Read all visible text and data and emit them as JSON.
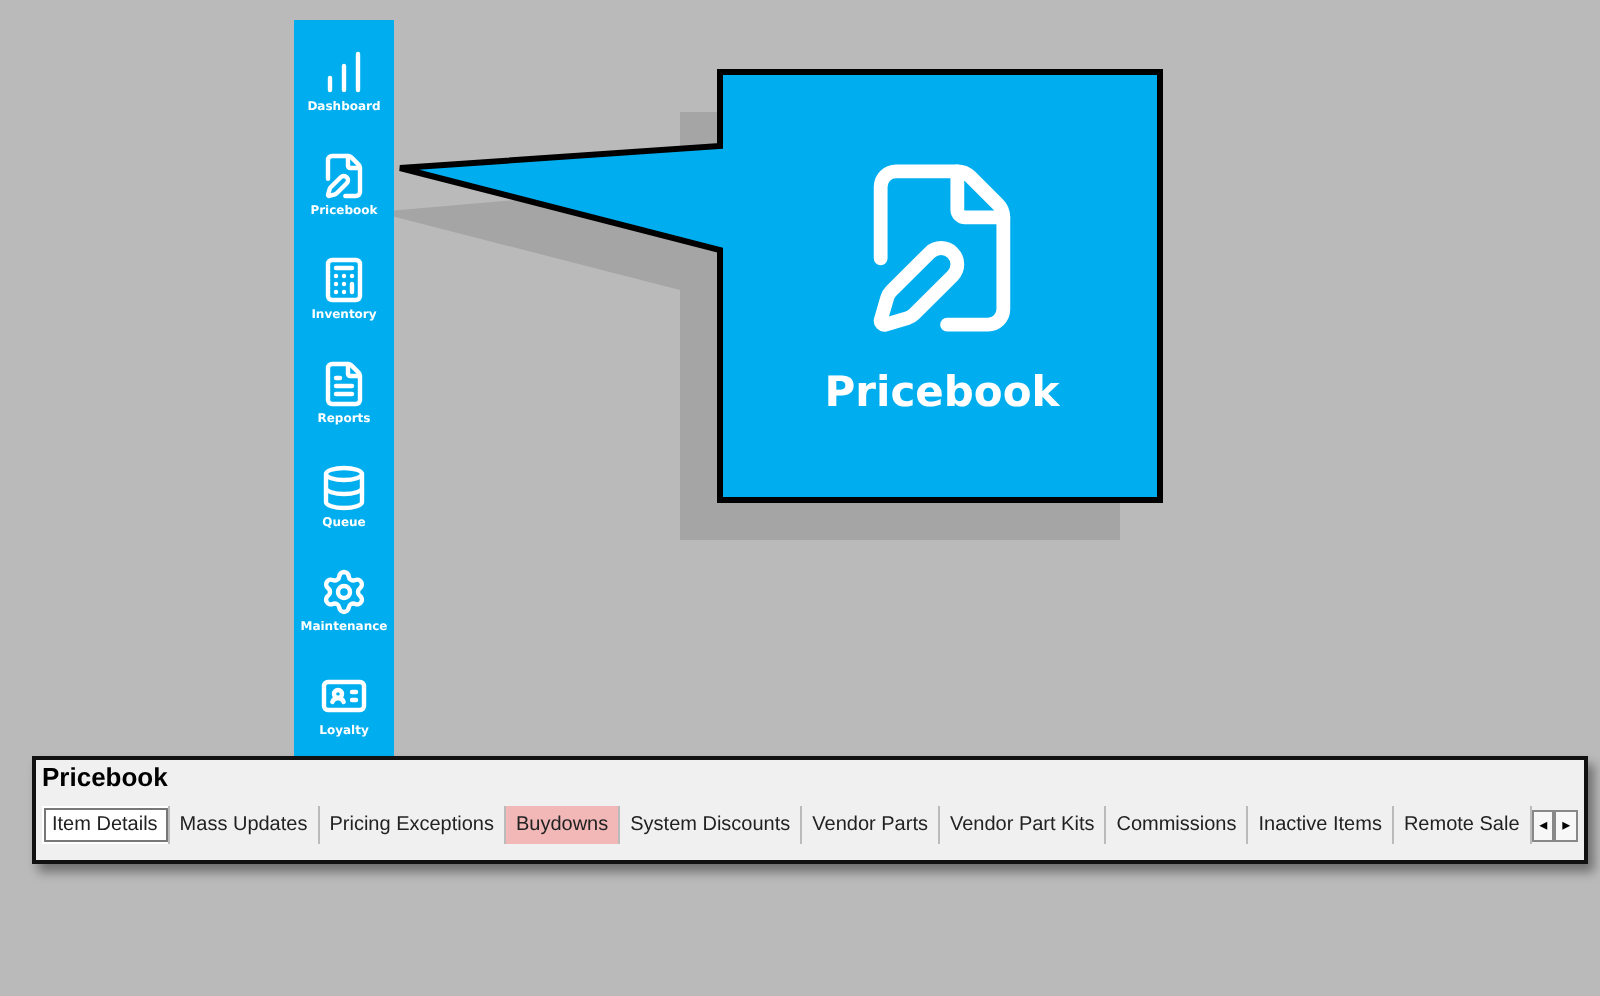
{
  "sidebar": {
    "items": [
      {
        "label": "Dashboard"
      },
      {
        "label": "Pricebook"
      },
      {
        "label": "Inventory"
      },
      {
        "label": "Reports"
      },
      {
        "label": "Queue"
      },
      {
        "label": "Maintenance"
      },
      {
        "label": "Loyalty"
      }
    ]
  },
  "callout": {
    "label": "Pricebook"
  },
  "panel": {
    "title": "Pricebook",
    "tabs": [
      {
        "label": "Item Details",
        "selected": true,
        "highlighted": false
      },
      {
        "label": "Mass Updates",
        "selected": false,
        "highlighted": false
      },
      {
        "label": "Pricing Exceptions",
        "selected": false,
        "highlighted": false
      },
      {
        "label": "Buydowns",
        "selected": false,
        "highlighted": true
      },
      {
        "label": "System Discounts",
        "selected": false,
        "highlighted": false
      },
      {
        "label": "Vendor Parts",
        "selected": false,
        "highlighted": false
      },
      {
        "label": "Vendor Part Kits",
        "selected": false,
        "highlighted": false
      },
      {
        "label": "Commissions",
        "selected": false,
        "highlighted": false
      },
      {
        "label": "Inactive Items",
        "selected": false,
        "highlighted": false
      },
      {
        "label": "Remote Sale",
        "selected": false,
        "highlighted": false
      }
    ],
    "scroll_buttons": [
      "◂",
      "▸"
    ]
  }
}
